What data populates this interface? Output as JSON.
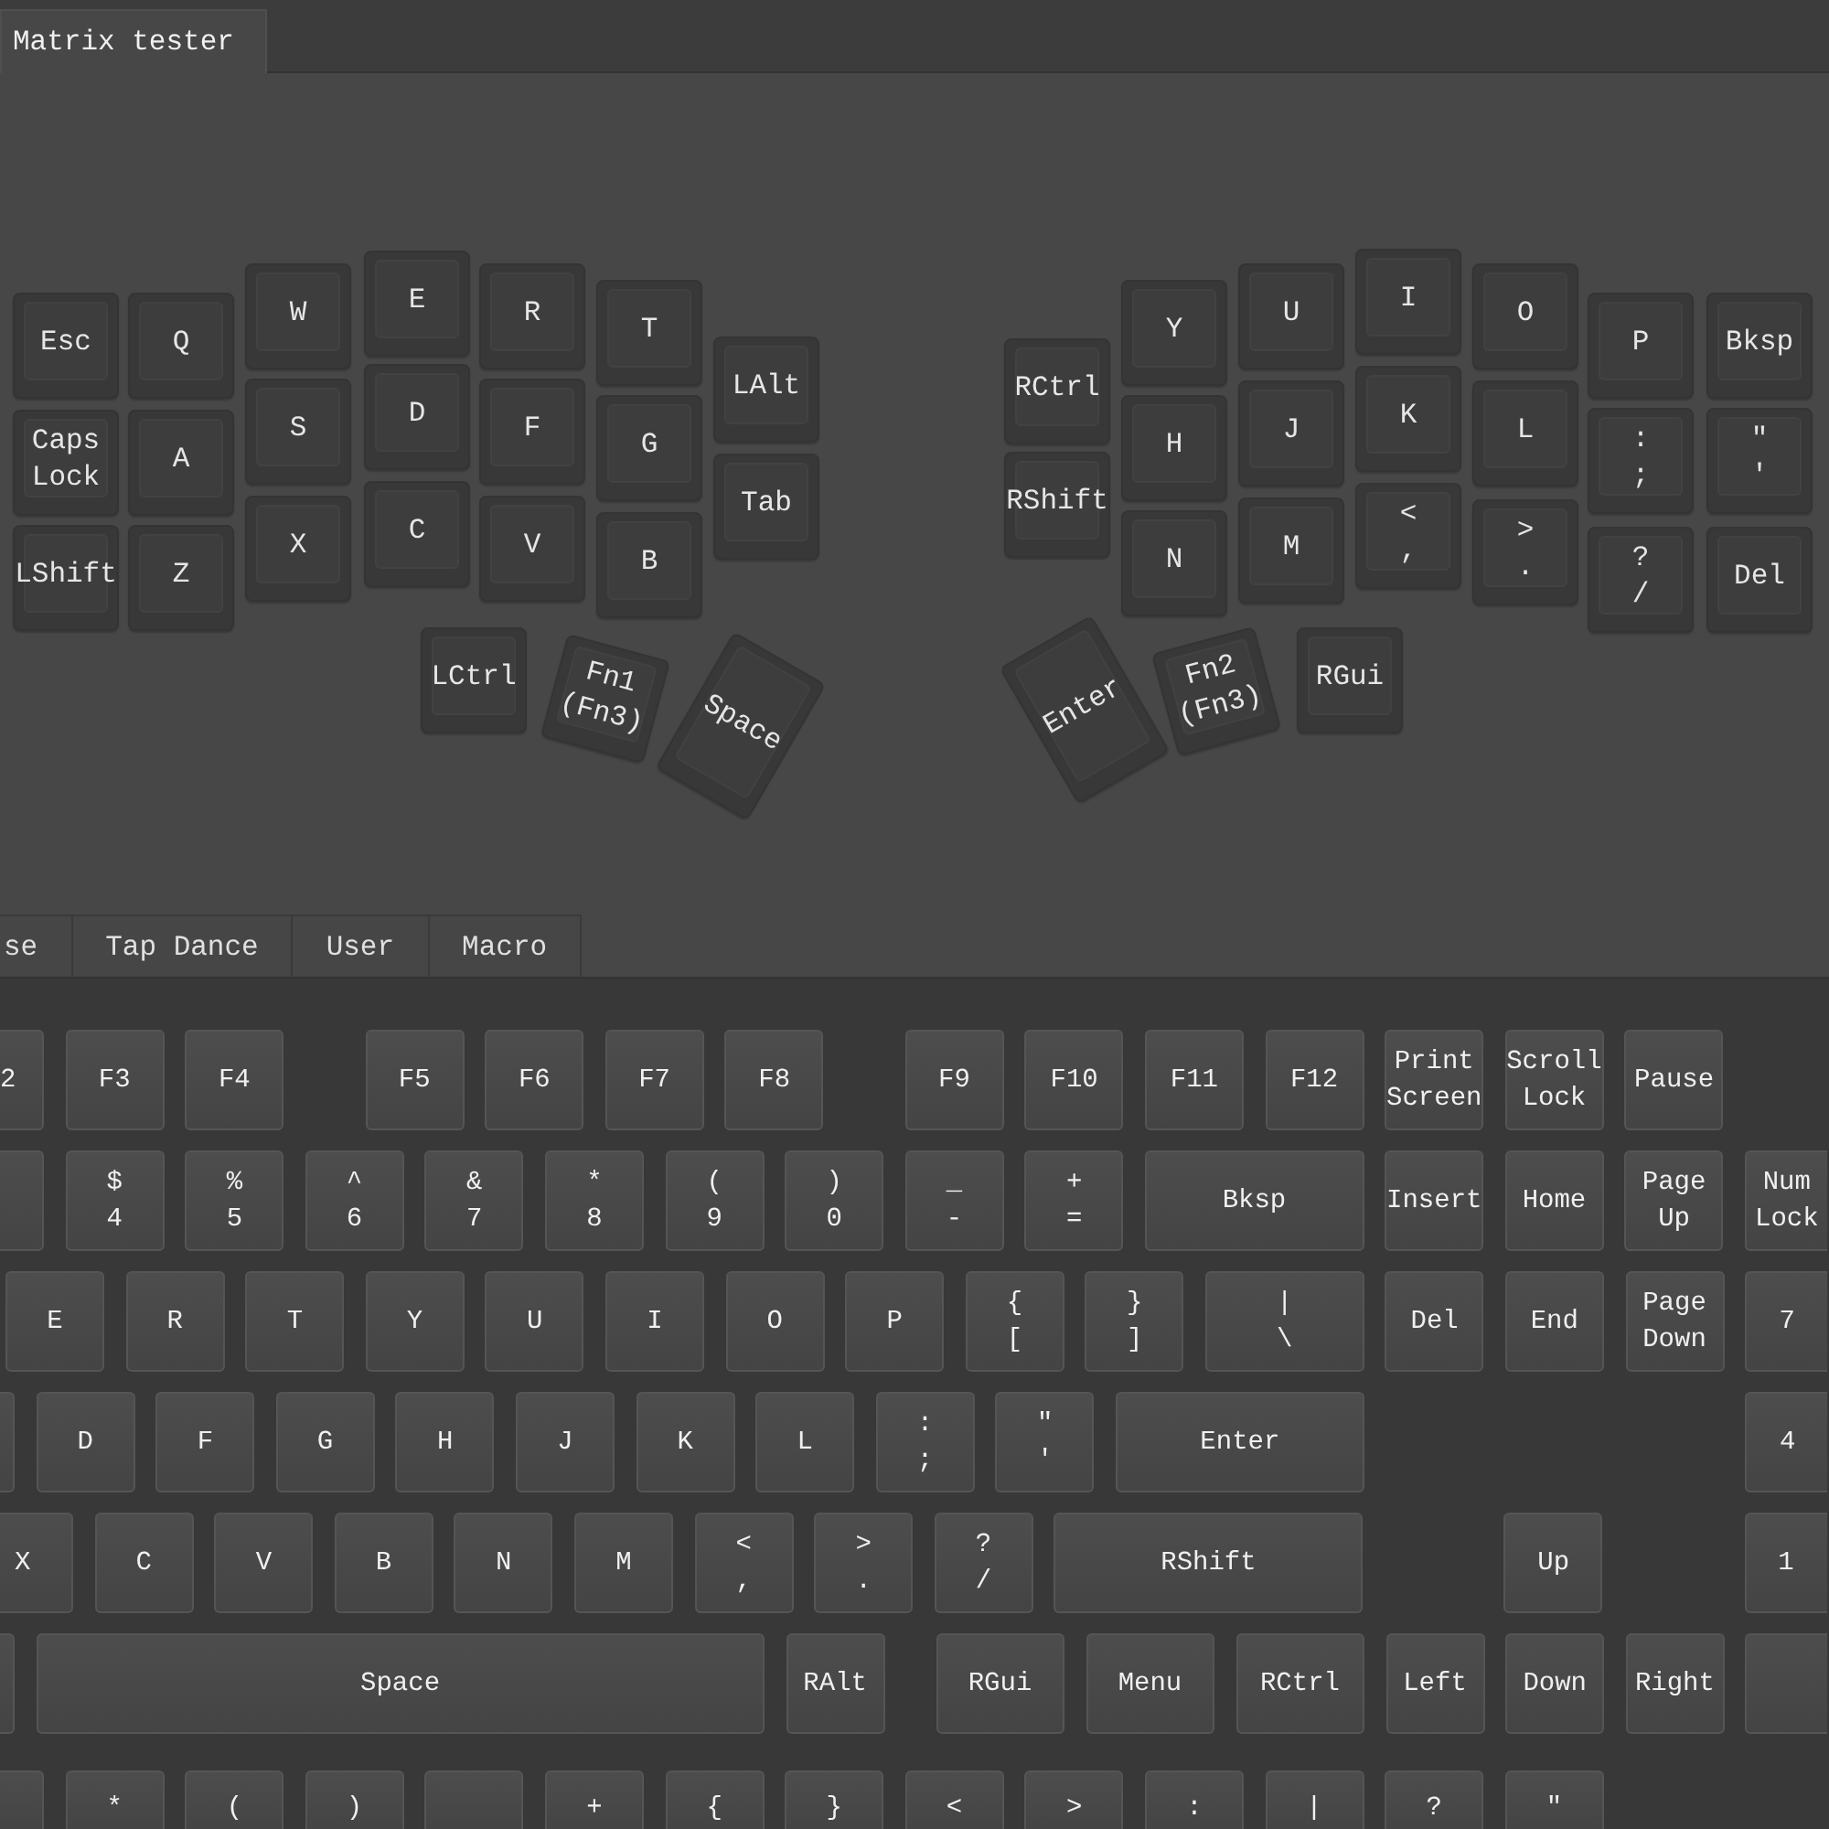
{
  "tabs": [
    {
      "label": "Matrix tester",
      "selected": true
    }
  ],
  "split_keyboard": {
    "keys": [
      "Esc",
      "Q",
      "W",
      "E",
      "R",
      "T",
      "LAlt",
      "Caps\nLock",
      "A",
      "S",
      "D",
      "F",
      "G",
      "Tab",
      "LShift",
      "Z",
      "X",
      "C",
      "V",
      "B",
      "LCtrl",
      "Fn1\n(Fn3)",
      "Space",
      "RCtrl",
      "Y",
      "U",
      "I",
      "O",
      "P",
      "Bksp",
      "RShift",
      "H",
      "J",
      "K",
      "L",
      ":\n;",
      "\"\n'",
      "N",
      "M",
      "<\n,",
      ">\n.",
      "?\n/",
      "Del",
      "Enter",
      "Fn2\n(Fn3)",
      "RGui"
    ]
  },
  "keycode_tabs": [
    {
      "label": "se",
      "selected": false
    },
    {
      "label": "Tap Dance",
      "selected": false
    },
    {
      "label": "User",
      "selected": false
    },
    {
      "label": "Macro",
      "selected": false
    }
  ],
  "keyboard": {
    "keys": [
      "2",
      "F3",
      "F4",
      "F5",
      "F6",
      "F7",
      "F8",
      "F9",
      "F10",
      "F11",
      "F12",
      "Print\nScreen",
      "Scroll\nLock",
      "Pause",
      "$\n4",
      "%\n5",
      "^\n6",
      "&\n7",
      "*\n8",
      "(\n9",
      ")\n0",
      "_\n-",
      "+\n=",
      "Bksp",
      "Insert",
      "Home",
      "Page\nUp",
      "Num\nLock",
      "E",
      "R",
      "T",
      "Y",
      "U",
      "I",
      "O",
      "P",
      "{\n[",
      "}\n]",
      "|\n\\",
      "Del",
      "End",
      "Page\nDown",
      "7",
      "D",
      "F",
      "G",
      "H",
      "J",
      "K",
      "L",
      ":\n;",
      "\"\n'",
      "Enter",
      "4",
      "X",
      "C",
      "V",
      "B",
      "N",
      "M",
      "<\n,",
      ">\n.",
      "?\n/",
      "RShift",
      "Up",
      "1",
      "Space",
      "RAlt",
      "RGui",
      "Menu",
      "RCtrl",
      "Left",
      "Down",
      "Right",
      "*",
      "(",
      ")",
      "+",
      "{",
      "}",
      "<",
      ">",
      ":",
      "|",
      "?",
      "\""
    ]
  }
}
